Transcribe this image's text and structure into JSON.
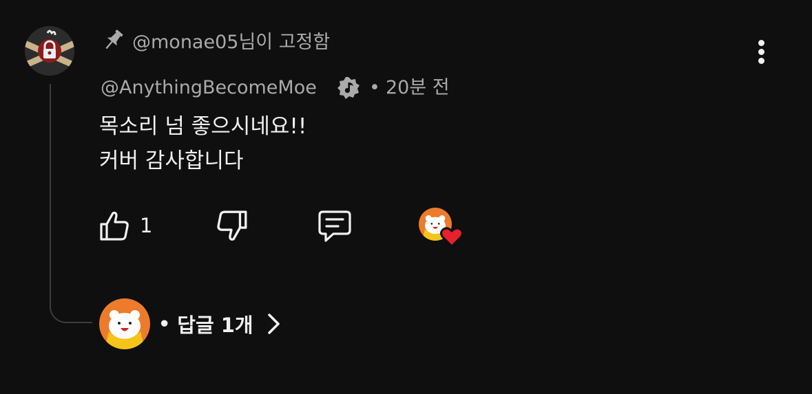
{
  "comment": {
    "pinned_text": "@monae05님이 고정함",
    "author": "@AnythingBecomeMoe",
    "separator": "•",
    "time": "20분 전",
    "lines": [
      "목소리 넘 좋으시네요!!",
      "커버 감사합니다"
    ],
    "like_count": "1"
  },
  "replies": {
    "dot": "•",
    "label": "답글 1개"
  },
  "icons": {
    "pin": "pin-icon",
    "badge": "music-note-badge-icon",
    "more": "more-vertical-icon",
    "like": "thumbs-up-icon",
    "dislike": "thumbs-down-icon",
    "reply": "comment-icon",
    "heart": "heart-icon",
    "chevron": "chevron-right-icon"
  },
  "colors": {
    "background": "#0f0f0f",
    "primary_text": "#f1f1f1",
    "secondary_text": "#aaaaaa",
    "heart": "#e5212e",
    "bear_orange": "#ec7c2b",
    "bear_yellow": "#f6c31a"
  }
}
